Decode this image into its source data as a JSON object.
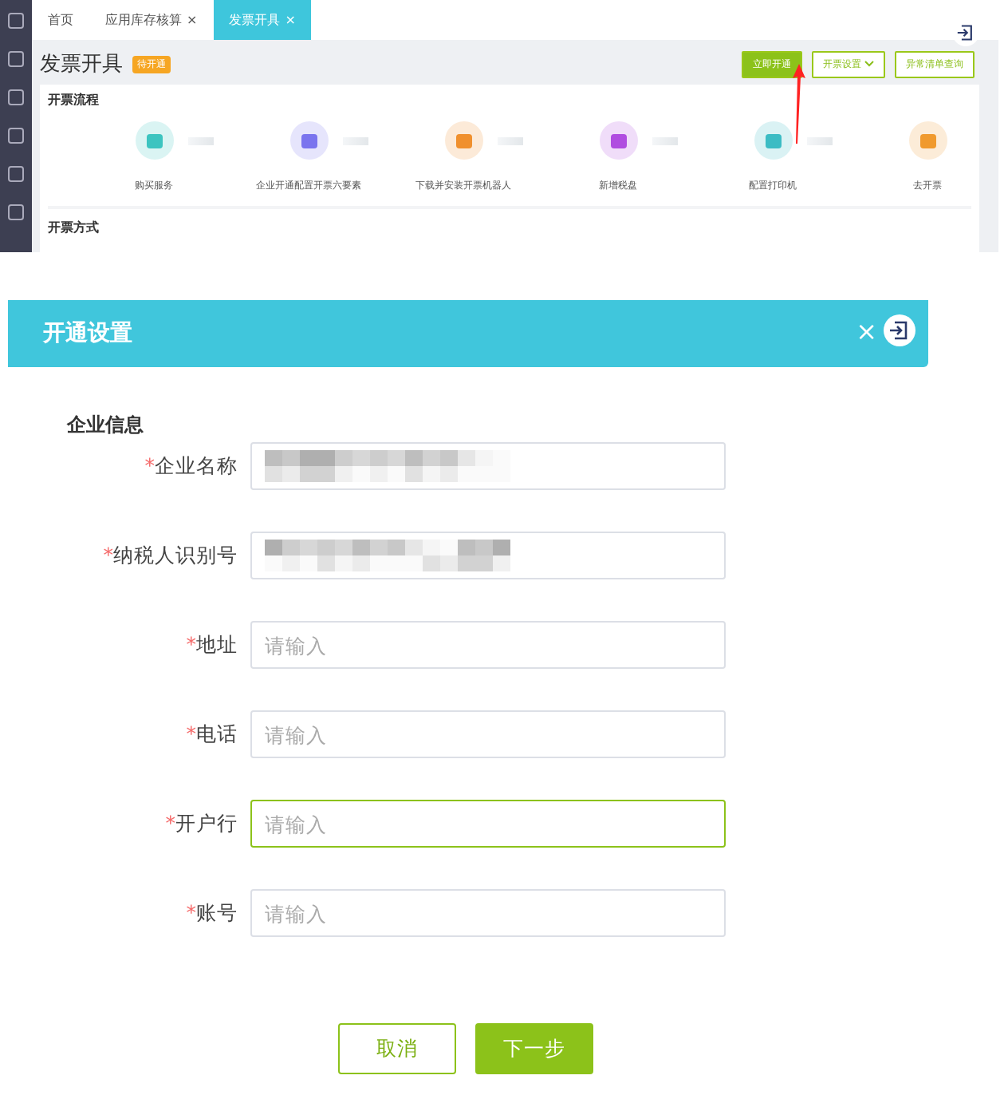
{
  "tabs": [
    {
      "label": "首页",
      "selected": false
    },
    {
      "label": "应用库存核算",
      "close": "×",
      "selected": false
    },
    {
      "label": "发票开具",
      "close": "×",
      "selected": true
    }
  ],
  "page": {
    "title": "发票开具",
    "badge": "待开通",
    "actions": [
      {
        "label": "立即开通",
        "kind": "primary"
      },
      {
        "label": "开票设置",
        "kind": "dropdown"
      },
      {
        "label": "异常清单查询",
        "kind": "outline"
      }
    ]
  },
  "process": {
    "title": "开票流程",
    "steps": [
      {
        "label": "购买服务",
        "color": "#3cc4c0"
      },
      {
        "label": "企业开通配置开票六要素",
        "color": "#7a74ee"
      },
      {
        "label": "下载并安装开票机器人",
        "color": "#f0902e"
      },
      {
        "label": "新增税盘",
        "color": "#b04de0"
      },
      {
        "label": "配置打印机",
        "color": "#3cbcc4"
      },
      {
        "label": "去开票",
        "color": "#f09a2e"
      }
    ]
  },
  "methods": {
    "title": "开票方式"
  },
  "dialog": {
    "title": "开通设置",
    "close": "×",
    "section": "企业信息",
    "fields": [
      {
        "label": "企业名称",
        "required_mark": "*",
        "kind": "redacted",
        "focused": false
      },
      {
        "label": "纳税人识别号",
        "required_mark": "*",
        "kind": "redacted",
        "focused": false
      },
      {
        "label": "地址",
        "required_mark": "*",
        "kind": "text",
        "placeholder": "请输入",
        "focused": false
      },
      {
        "label": "电话",
        "required_mark": "*",
        "kind": "text",
        "placeholder": "请输入",
        "focused": false
      },
      {
        "label": "开户行",
        "required_mark": "*",
        "kind": "text",
        "placeholder": "请输入",
        "focused": true
      },
      {
        "label": "账号",
        "required_mark": "*",
        "kind": "text",
        "placeholder": "请输入",
        "focused": false
      }
    ],
    "buttons": [
      {
        "label": "取消",
        "kind": "secondary"
      },
      {
        "label": "下一步",
        "kind": "primary"
      }
    ]
  }
}
